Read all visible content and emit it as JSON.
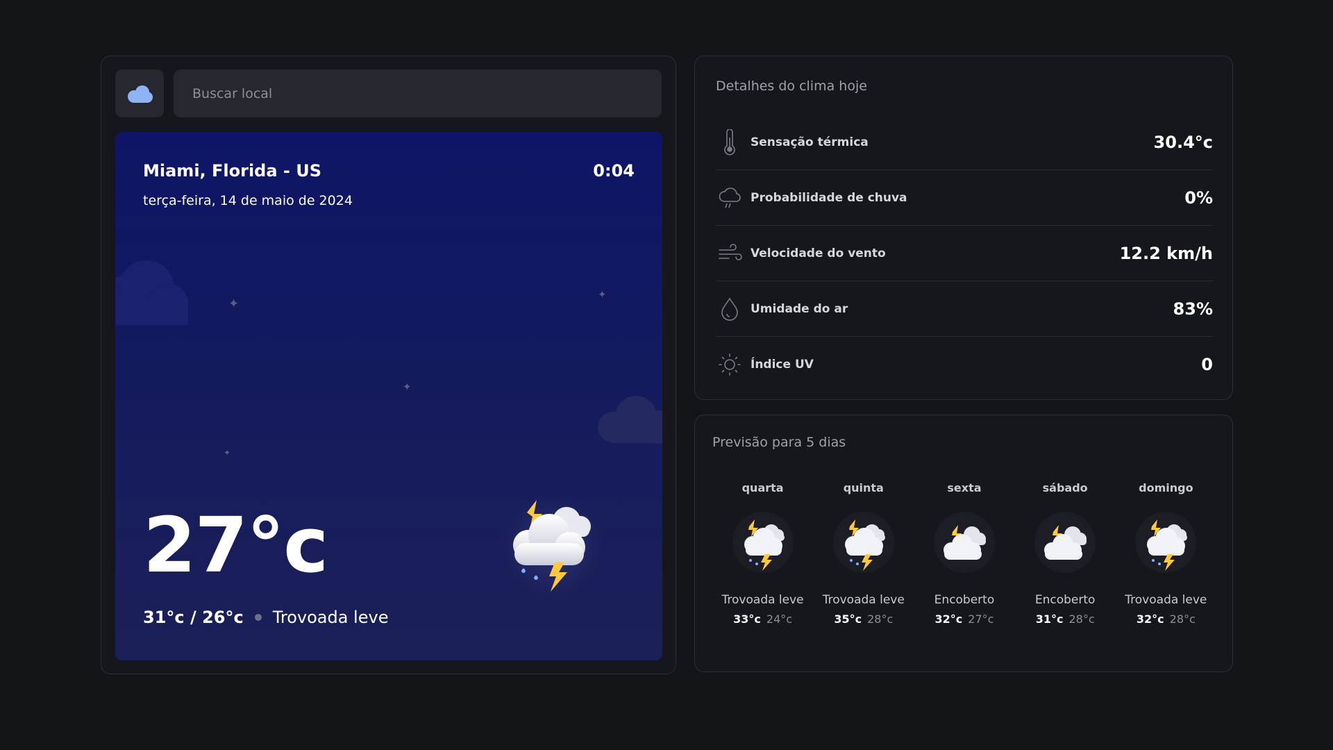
{
  "search": {
    "placeholder": "Buscar local",
    "logo_icon": "cloud-logo-icon"
  },
  "current": {
    "city": "Miami, Florida - US",
    "time": "0:04",
    "date": "terça-feira, 14 de maio de 2024",
    "temperature": "27°c",
    "minmax": "31°c / 26°c",
    "condition": "Trovoada leve",
    "icon": "thunderstorm-rain-icon"
  },
  "details": {
    "title": "Detalhes do clima hoje",
    "items": [
      {
        "label": "Sensação térmica",
        "value": "30.4°c",
        "icon": "thermometer-icon"
      },
      {
        "label": "Probabilidade de chuva",
        "value": "0%",
        "icon": "cloud-rain-icon"
      },
      {
        "label": "Velocidade do vento",
        "value": "12.2 km/h",
        "icon": "wind-icon"
      },
      {
        "label": "Umidade do ar",
        "value": "83%",
        "icon": "droplet-icon"
      },
      {
        "label": "Índice UV",
        "value": "0",
        "icon": "sun-icon"
      }
    ]
  },
  "forecast": {
    "title": "Previsão para 5 dias",
    "days": [
      {
        "day": "quarta",
        "condition": "Trovoada leve",
        "max": "33°c",
        "min": "24°c",
        "icon": "thunderstorm-rain-icon"
      },
      {
        "day": "quinta",
        "condition": "Trovoada leve",
        "max": "35°c",
        "min": "28°c",
        "icon": "thunderstorm-rain-icon"
      },
      {
        "day": "sexta",
        "condition": "Encoberto",
        "max": "32°c",
        "min": "27°c",
        "icon": "overcast-icon"
      },
      {
        "day": "sábado",
        "condition": "Encoberto",
        "max": "31°c",
        "min": "28°c",
        "icon": "overcast-icon"
      },
      {
        "day": "domingo",
        "condition": "Trovoada leve",
        "max": "32°c",
        "min": "28°c",
        "icon": "thunderstorm-rain-icon"
      }
    ]
  },
  "colors": {
    "background": "#131418",
    "panel": "#16171c",
    "hero_top": "#0e1566",
    "hero_bottom": "#1c2058",
    "accent_logo": "#8fb4f5"
  }
}
